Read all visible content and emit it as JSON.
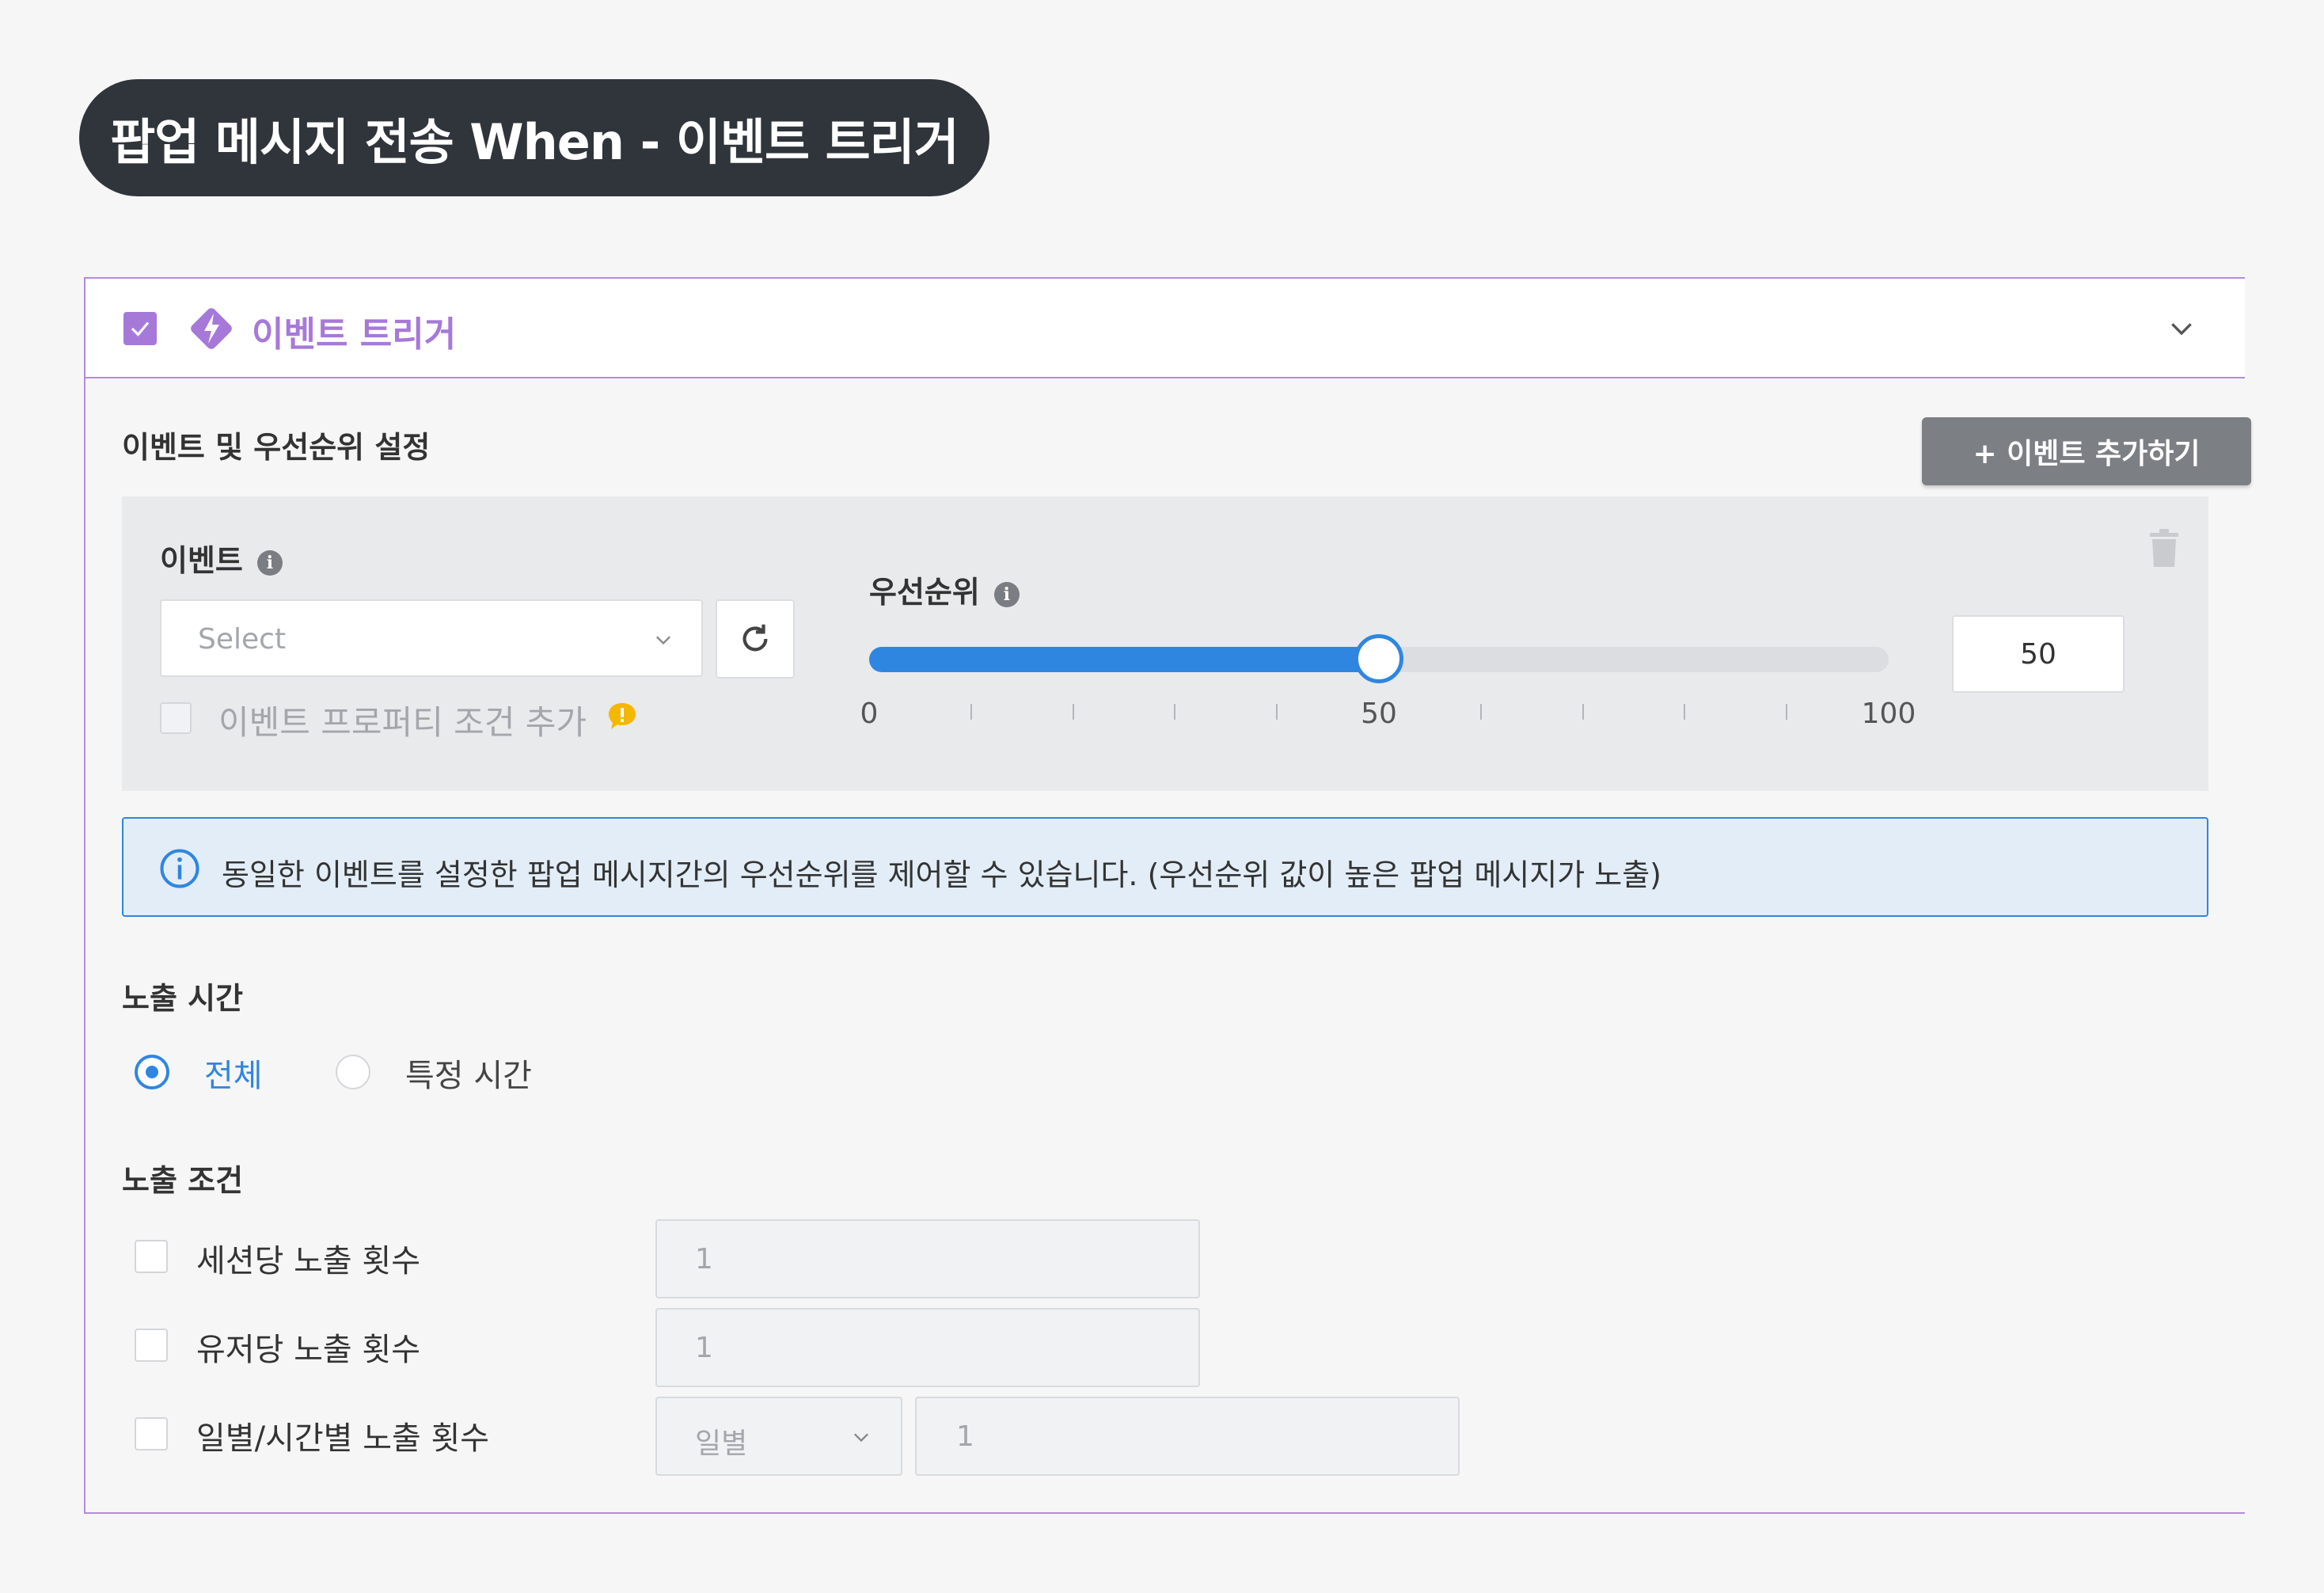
{
  "page_title": "팝업 메시지 전송 When - 이벤트 트리거",
  "panel": {
    "title": "이벤트 트리거",
    "checked": true
  },
  "events_section": {
    "title": "이벤트 및 우선순위 설정",
    "add_button": "+ 이벤트 추가하기",
    "event_label": "이벤트",
    "select_placeholder": "Select",
    "property_condition_label": "이벤트 프로퍼티 조건 추가",
    "priority_label": "우선순위",
    "priority_value": "50",
    "slider": {
      "min": 0,
      "max": 100,
      "value": 50,
      "tick_labels": [
        "0",
        "50",
        "100"
      ]
    }
  },
  "notice": {
    "text": "동일한 이벤트를 설정한 팝업 메시지간의 우선순위를 제어할 수 있습니다. (우선순위 값이 높은 팝업 메시지가 노출)"
  },
  "exposure_time": {
    "title": "노출 시간",
    "options": [
      {
        "label": "전체",
        "selected": true
      },
      {
        "label": "특정 시간",
        "selected": false
      }
    ]
  },
  "exposure_conditions": {
    "title": "노출 조건",
    "items": [
      {
        "label": "세션당 노출 횟수",
        "value": "1"
      },
      {
        "label": "유저당 노출 횟수",
        "value": "1"
      },
      {
        "label": "일별/시간별 노출 횟수",
        "period": "일별",
        "value": "1"
      }
    ]
  },
  "colors": {
    "accent_purple": "#a679d9",
    "accent_blue": "#2f86e0",
    "title_pill": "#30353b"
  }
}
